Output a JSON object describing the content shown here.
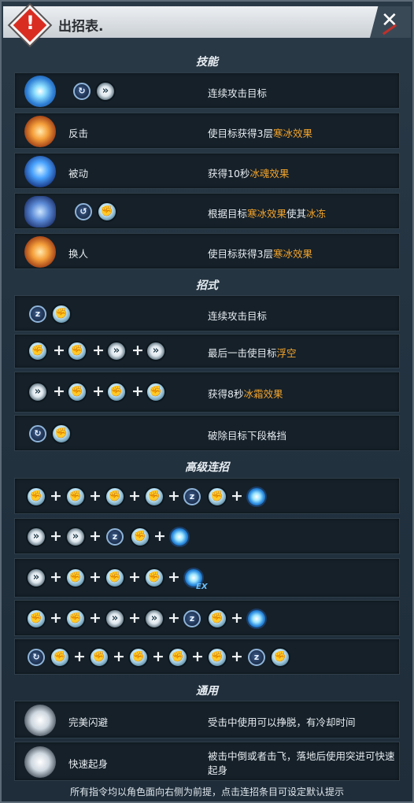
{
  "header": {
    "title": "出招表."
  },
  "sections": {
    "skills": "技能",
    "moves": "招式",
    "advanced": "高级连招",
    "common": "通用"
  },
  "skills": [
    {
      "label": "",
      "desc_pre": "连续攻击目标",
      "desc_hl": "",
      "desc_mid": "",
      "desc_hl2": ""
    },
    {
      "label": "反击",
      "desc_pre": "使目标获得3层",
      "desc_hl": "寒冰效果",
      "desc_mid": "",
      "desc_hl2": ""
    },
    {
      "label": "被动",
      "desc_pre": "获得10秒",
      "desc_hl": "冰魂效果",
      "desc_mid": "",
      "desc_hl2": ""
    },
    {
      "label": "",
      "desc_pre": "根据目标",
      "desc_hl": "寒冰效果",
      "desc_mid": "使其",
      "desc_hl2": "冰冻"
    },
    {
      "label": "换人",
      "desc_pre": "使目标获得3层",
      "desc_hl": "寒冰效果",
      "desc_mid": "",
      "desc_hl2": ""
    }
  ],
  "moves": [
    {
      "desc_pre": "连续攻击目标",
      "desc_hl": ""
    },
    {
      "desc_pre": "最后一击使目标",
      "desc_hl": "浮空"
    },
    {
      "desc_pre": "获得8秒",
      "desc_hl": "冰霜效果"
    },
    {
      "desc_pre": "破除目标下段格挡",
      "desc_hl": ""
    }
  ],
  "combo_plus": "+",
  "ex_label": "EX",
  "common": [
    {
      "label": "完美闪避",
      "desc": "受击中使用可以挣脱，有冷却时间",
      "desc2": ""
    },
    {
      "label": "快速起身",
      "desc": "被击中倒或者击飞，落地后使用突进可快速",
      "desc2": "起身"
    }
  ],
  "footer": "所有指令均以角色面向右侧为前提，点击连招条目可设定默认提示",
  "colors": {
    "highlight": "#f2a32a",
    "header_red": "#d92d21"
  }
}
